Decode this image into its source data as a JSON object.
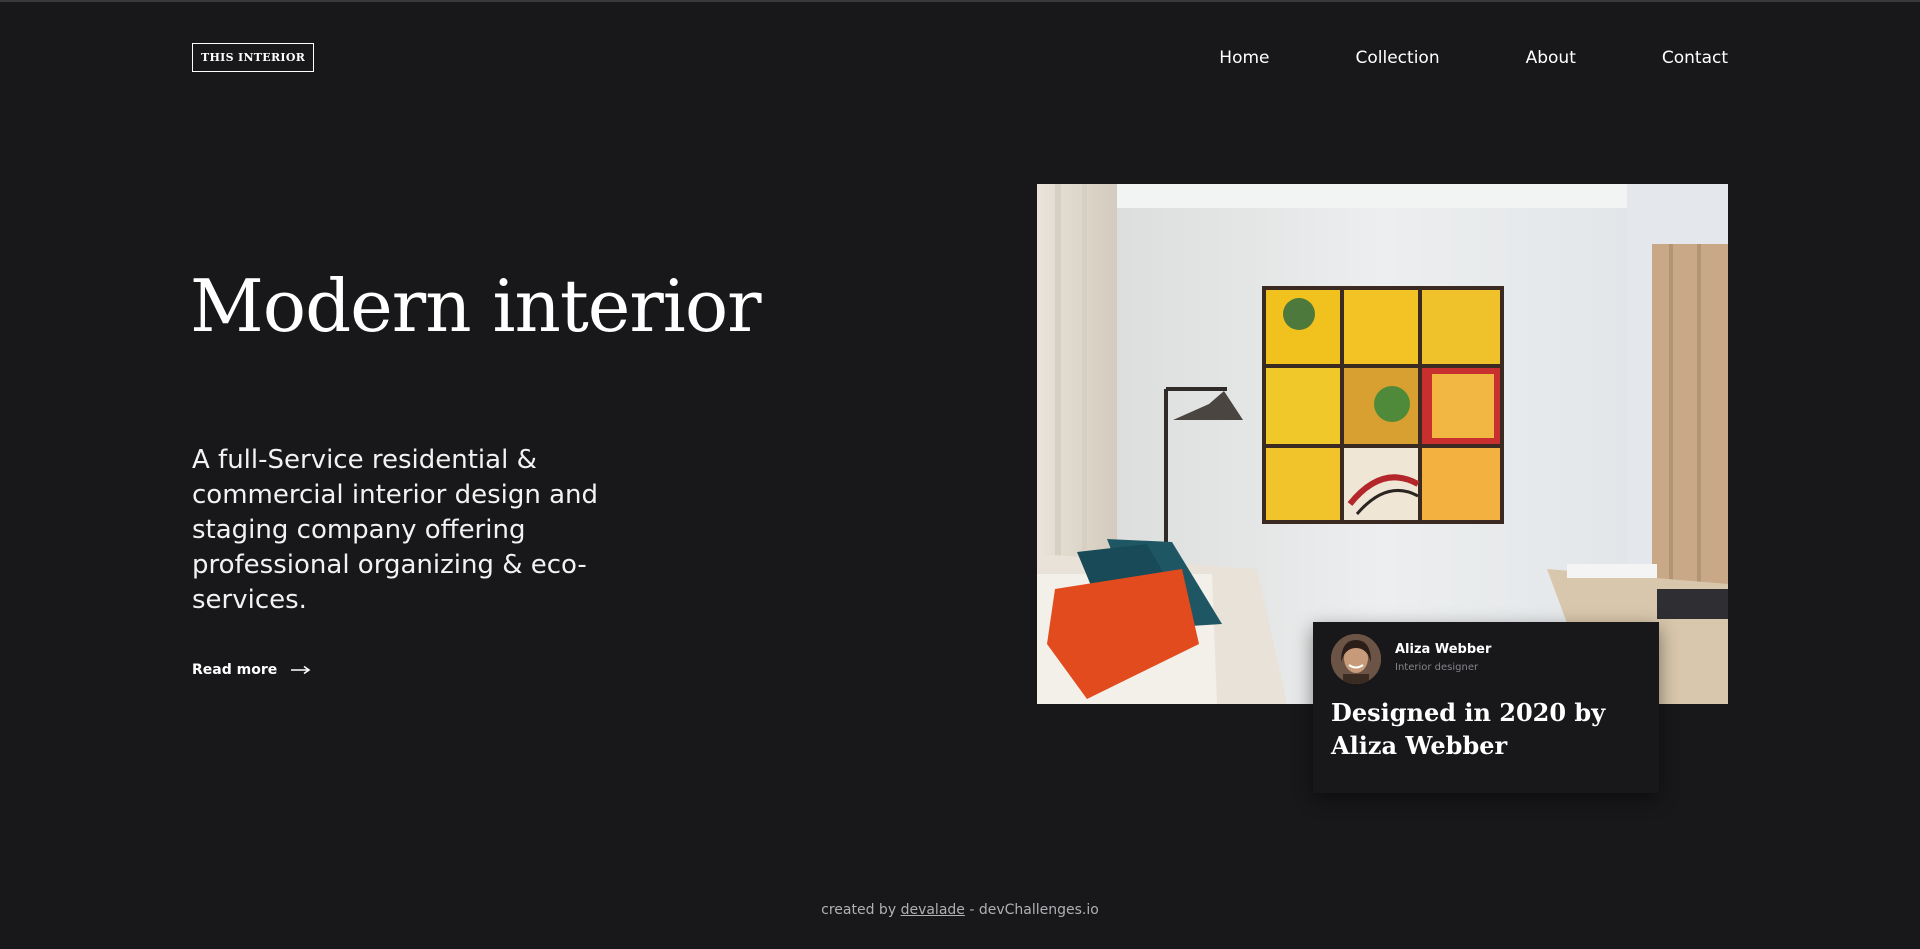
{
  "header": {
    "logo": "THIS INTERIOR",
    "nav": [
      "Home",
      "Collection",
      "About",
      "Contact"
    ]
  },
  "hero": {
    "title": "Modern interior",
    "description": "A full-Service residential & commercial interior design and staging company offering professional organizing & eco-services.",
    "read_more": "Read more",
    "arrow_icon": "arrow-right-icon"
  },
  "designer_card": {
    "name": "Aliza Webber",
    "role": "Interior designer",
    "caption": "Designed in 2020 by Aliza Webber",
    "avatar_icon": "avatar"
  },
  "footer": {
    "prefix": "created by",
    "author": "devalade",
    "suffix": "- devChallenges.io"
  },
  "colors": {
    "background": "#18181a",
    "text": "#ffffff",
    "muted": "#85858a"
  }
}
